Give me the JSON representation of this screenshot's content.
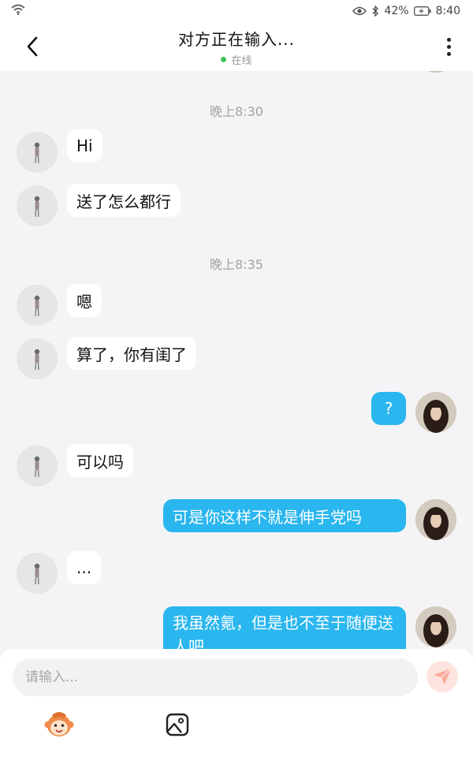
{
  "status_bar": {
    "battery_percent": "42%",
    "time": "8:40",
    "icons": [
      "wifi-icon",
      "eye-icon",
      "bluetooth-icon",
      "battery-icon"
    ]
  },
  "header": {
    "title": "对方正在输入...",
    "status": "在线",
    "status_color": "#3cc456"
  },
  "chat": {
    "time_separators": [
      "晚上8:30",
      "晚上8:35"
    ],
    "messages": [
      {
        "side": "left",
        "text": "Hi"
      },
      {
        "side": "left",
        "text": "送了怎么都行"
      },
      {
        "side": "left",
        "text": "嗯"
      },
      {
        "side": "left",
        "text": "算了，你有闺了"
      },
      {
        "side": "right",
        "text": "?"
      },
      {
        "side": "left",
        "text": "可以吗"
      },
      {
        "side": "right",
        "text": "可是你这样不就是伸手党吗"
      },
      {
        "side": "left",
        "text": "..."
      },
      {
        "side": "right",
        "text": "我虽然氪，但是也不至于随便送人吧"
      }
    ]
  },
  "input": {
    "placeholder": "请输入..."
  },
  "colors": {
    "self_bubble": "#2ab6ee",
    "other_bubble": "#ffffff",
    "background": "#f4f4f6",
    "send_button": "#fde4df"
  }
}
